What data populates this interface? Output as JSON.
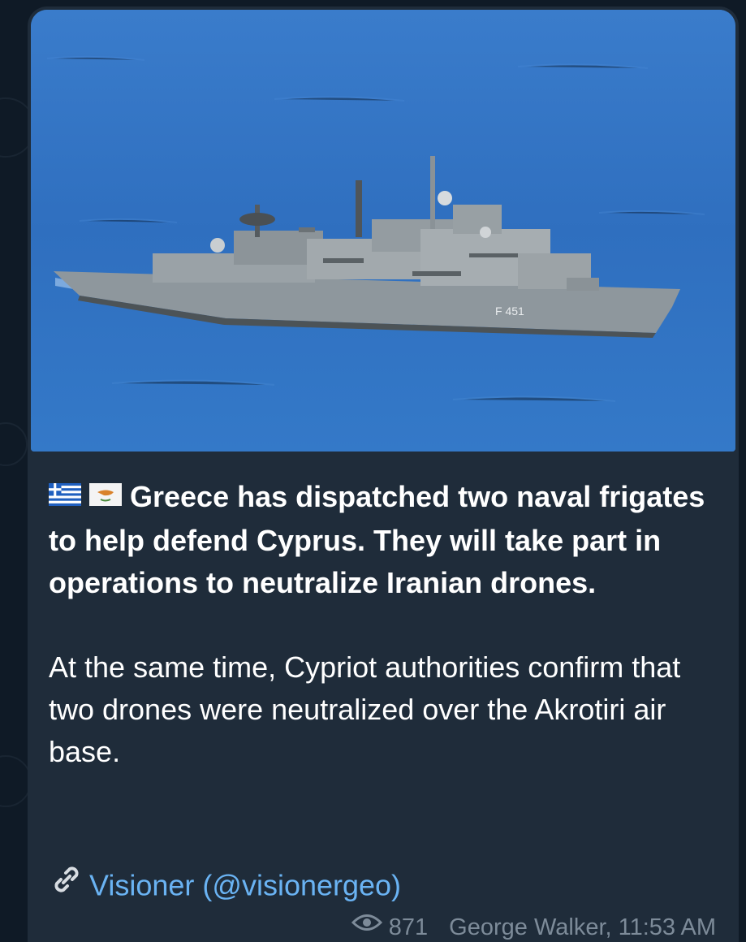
{
  "message": {
    "paragraph_1": "Greece has dispatched two naval frigates to help defend Cyprus. They will take part in operations to neutralize Iranian drones.",
    "paragraph_2": "At the same time, Cypriot authorities confirm that two drones were neutralized over the Akrotiri air base.",
    "flags": [
      "greece-flag-icon",
      "cyprus-flag-icon"
    ],
    "source_link_text": "Visioner (@visionergeo)",
    "views": "871",
    "author_time": "George Walker, 11:53 AM"
  },
  "photo": {
    "hull_marking": "F 451",
    "description_icon": "warship-photo"
  },
  "colors": {
    "bubble": "#1f2c3a",
    "link": "#6ab3f3",
    "meta": "#7d8b99",
    "sea": "#2f6fbd"
  }
}
